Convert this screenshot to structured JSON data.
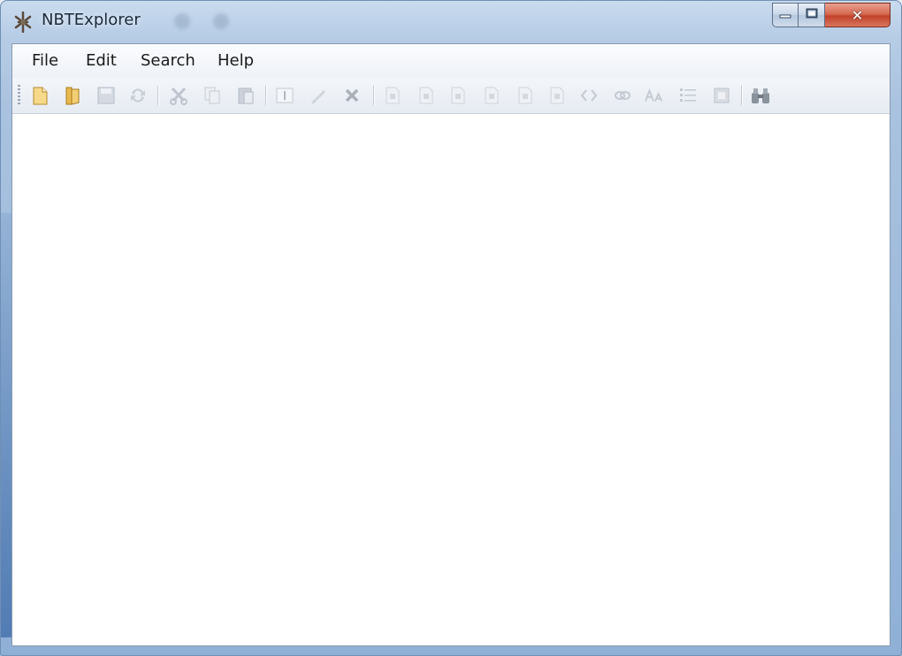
{
  "window": {
    "title": "NBTExplorer",
    "caption_buttons": {
      "minimize_icon": "minimize-icon",
      "maximize_icon": "maximize-icon",
      "close_icon": "close-icon",
      "close_glyph": "✕"
    }
  },
  "menu": {
    "items": [
      "File",
      "Edit",
      "Search",
      "Help"
    ]
  },
  "toolbar": {
    "buttons": [
      {
        "icon": "new-file-icon",
        "enabled": true
      },
      {
        "icon": "open-folder-icon",
        "enabled": true
      },
      {
        "icon": "save-icon",
        "enabled": false
      },
      {
        "icon": "refresh-icon",
        "enabled": false
      },
      {
        "icon": "cut-icon",
        "enabled": false
      },
      {
        "icon": "copy-icon",
        "enabled": false
      },
      {
        "icon": "paste-icon",
        "enabled": false
      },
      {
        "icon": "rename-icon",
        "enabled": false
      },
      {
        "icon": "edit-pencil-icon",
        "enabled": false
      },
      {
        "icon": "delete-icon",
        "enabled": false
      },
      {
        "icon": "add-byte-tag-icon",
        "enabled": false
      },
      {
        "icon": "add-short-tag-icon",
        "enabled": false
      },
      {
        "icon": "add-int-tag-icon",
        "enabled": false
      },
      {
        "icon": "add-long-tag-icon",
        "enabled": false
      },
      {
        "icon": "add-float-tag-icon",
        "enabled": false
      },
      {
        "icon": "add-double-tag-icon",
        "enabled": false
      },
      {
        "icon": "add-byte-array-icon",
        "enabled": false
      },
      {
        "icon": "add-int-array-icon",
        "enabled": false
      },
      {
        "icon": "add-string-tag-icon",
        "enabled": false
      },
      {
        "icon": "add-list-tag-icon",
        "enabled": false
      },
      {
        "icon": "add-compound-tag-icon",
        "enabled": false
      },
      {
        "icon": "find-binoculars-icon",
        "enabled": true
      }
    ]
  },
  "colors": {
    "titlebar": "#b7cde6",
    "close_button": "#c2432a",
    "client_background": "#ffffff"
  }
}
